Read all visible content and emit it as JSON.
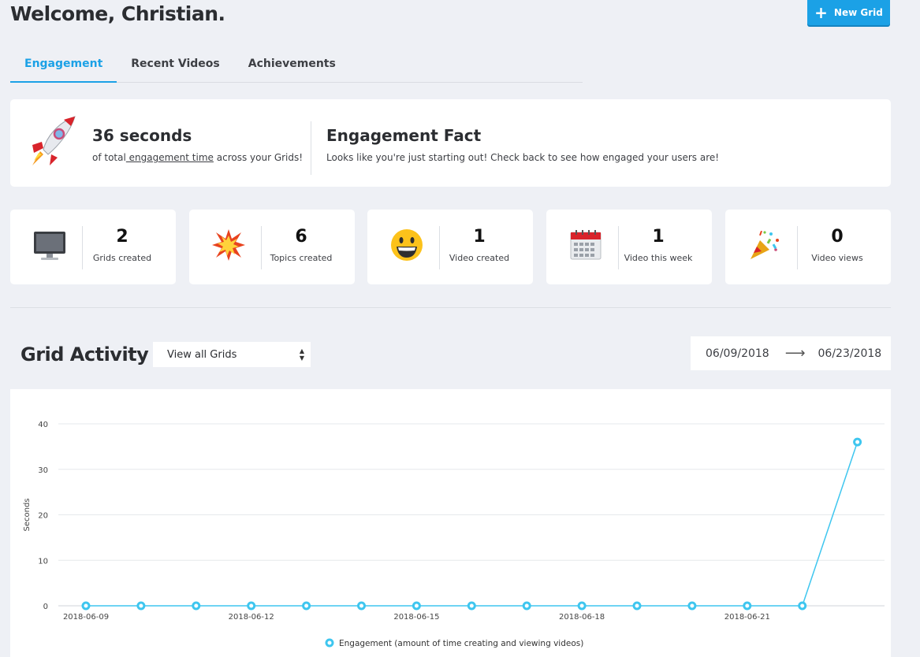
{
  "header": {
    "welcome": "Welcome, Christian.",
    "new_grid_label": "New Grid"
  },
  "tabs": [
    {
      "label": "Engagement",
      "active": true
    },
    {
      "label": "Recent Videos",
      "active": false
    },
    {
      "label": "Achievements",
      "active": false
    }
  ],
  "hero": {
    "value": "36 seconds",
    "sub_prefix": "of total",
    "sub_link": " engagement time",
    "sub_suffix": " across your Grids!",
    "fact_title": "Engagement Fact",
    "fact_text": "Looks like you're just starting out! Check back to see how engaged your users are!"
  },
  "stats": [
    {
      "icon": "monitor-icon",
      "value": "2",
      "label": "Grids created"
    },
    {
      "icon": "explosion-icon",
      "value": "6",
      "label": "Topics created"
    },
    {
      "icon": "smiley-icon",
      "value": "1",
      "label": "Video created"
    },
    {
      "icon": "calendar-icon",
      "value": "1",
      "label": "Video this week"
    },
    {
      "icon": "party-popper-icon",
      "value": "0",
      "label": "Video views"
    }
  ],
  "activity": {
    "title": "Grid Activity",
    "select_value": "View all Grids",
    "date_from": "06/09/2018",
    "date_to": "06/23/2018"
  },
  "colors": {
    "accent": "#1ba1e6",
    "line": "#3ec6ef",
    "background": "#eef0f5"
  },
  "chart_data": {
    "type": "line",
    "x": [
      "2018-06-09",
      "2018-06-10",
      "2018-06-11",
      "2018-06-12",
      "2018-06-13",
      "2018-06-14",
      "2018-06-15",
      "2018-06-16",
      "2018-06-17",
      "2018-06-18",
      "2018-06-19",
      "2018-06-20",
      "2018-06-21",
      "2018-06-22",
      "2018-06-23"
    ],
    "x_tick_labels": [
      "2018-06-09",
      "2018-06-12",
      "2018-06-15",
      "2018-06-18",
      "2018-06-21"
    ],
    "series": [
      {
        "name": "Engagement (amount of time creating and viewing videos)",
        "values": [
          0,
          0,
          0,
          0,
          0,
          0,
          0,
          0,
          0,
          0,
          0,
          0,
          0,
          0,
          36
        ]
      }
    ],
    "ylabel": "Seconds",
    "yticks": [
      0,
      10,
      20,
      30,
      40
    ],
    "ylim": [
      0,
      40
    ],
    "grid": true,
    "legend": "bottom-center"
  }
}
